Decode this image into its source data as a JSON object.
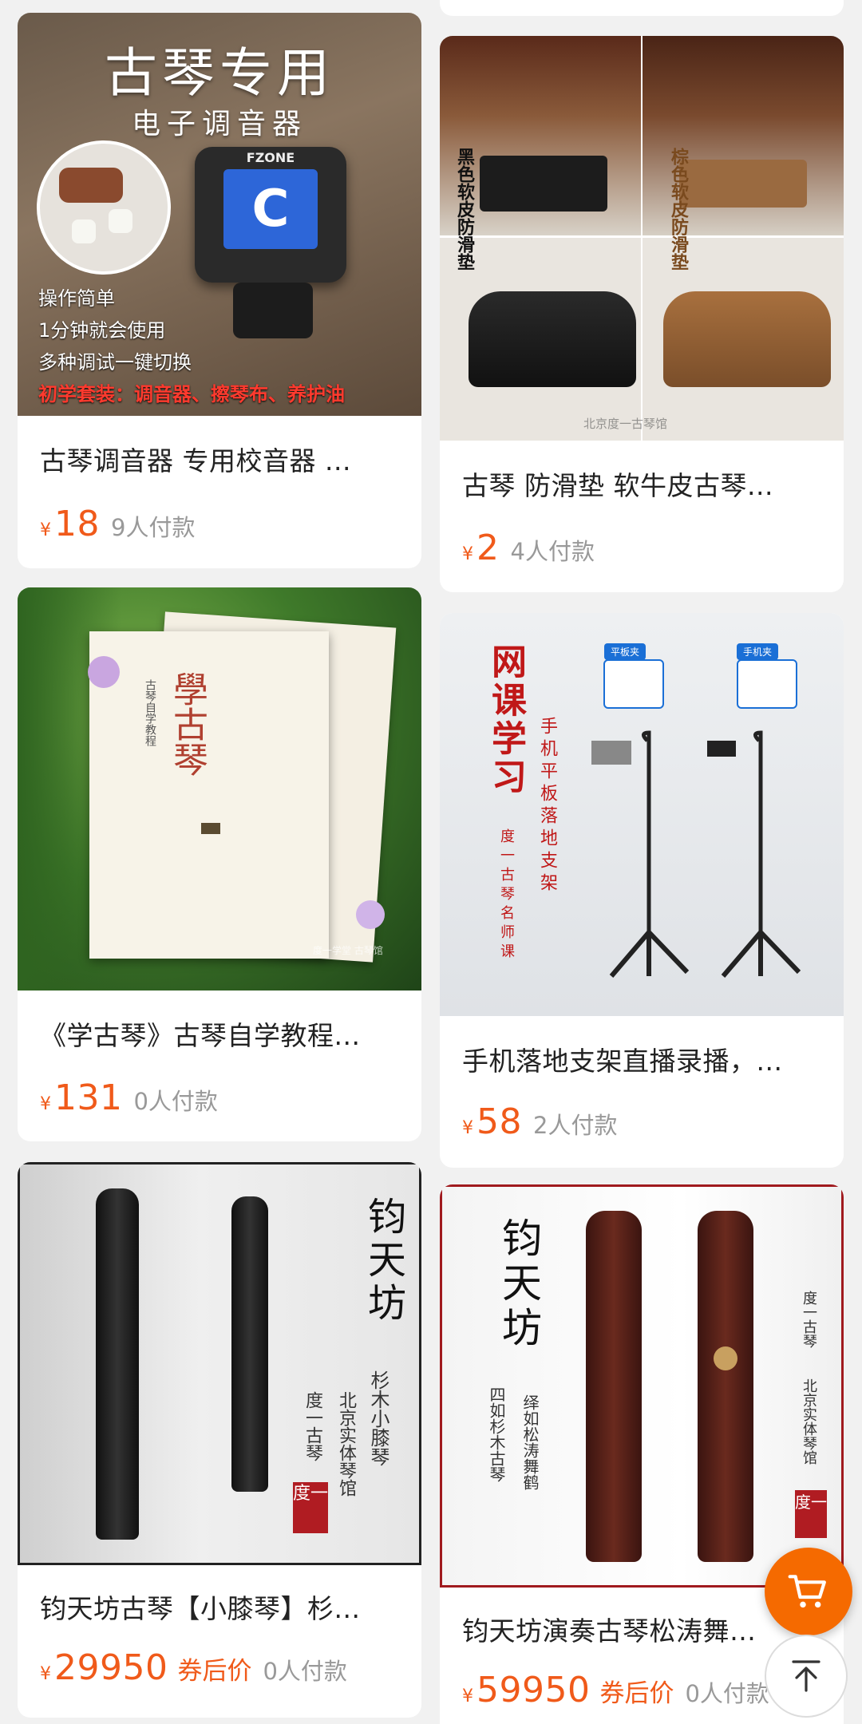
{
  "products": [
    {
      "title": "古琴调音器 专用校音器 ...",
      "currency": "¥",
      "price": "18",
      "sold": "9人付款",
      "image": {
        "headline": "古琴专用",
        "subhead": "电子调音器",
        "brand": "FZONE",
        "display_note": "C",
        "lines": [
          "操作简单",
          "1分钟就会使用",
          "多种调试一键切换"
        ],
        "kit": "初学套装：调音器、擦琴布、养护油"
      }
    },
    {
      "title": "古琴 防滑垫 软牛皮古琴...",
      "currency": "¥",
      "price": "2",
      "sold": "4人付款",
      "image": {
        "label_left": "黑色软皮防滑垫",
        "label_right": "棕色软皮防滑垫",
        "watermark": "北京度一古琴馆"
      }
    },
    {
      "title": "《学古琴》古琴自学教程...",
      "currency": "¥",
      "price": "131",
      "sold": "0人付款",
      "image": {
        "book_title": "學古琴",
        "book_sub": "古琴自学教程",
        "watermark": "度一学堂 古琴馆"
      }
    },
    {
      "title": "手机落地支架直播录播，...",
      "currency": "¥",
      "price": "58",
      "sold": "2人付款",
      "image": {
        "big": "网课学习",
        "mid": "手机平板落地支架",
        "small": "度一古琴名师课",
        "tag_left": "平板夹",
        "tag_right": "手机夹"
      }
    },
    {
      "title": "钧天坊古琴【小膝琴】杉...",
      "currency": "¥",
      "price": "29950",
      "coupon": "券后价",
      "sold": "0人付款",
      "image": {
        "brand": "钧天坊",
        "model": "杉木小膝琴",
        "shop": "北京实体琴馆",
        "shop2": "度一古琴",
        "seal": "度一"
      }
    },
    {
      "title": "钧天坊演奏古琴松涛舞鹤",
      "currency": "¥",
      "price": "59950",
      "coupon": "券后价",
      "sold": "0人付款",
      "image": {
        "brand": "钧天坊",
        "model1": "四如杉木古琴",
        "model2": "绎如松涛舞鹤",
        "shop": "度一古琴",
        "shop2": "北京实体琴馆",
        "seal": "度一"
      }
    }
  ],
  "fab": {
    "cart_icon": "cart-icon",
    "top_icon": "arrow-up-icon"
  },
  "colors": {
    "accent": "#f05a1a",
    "fab": "#f56a00",
    "seal": "#b01c22"
  }
}
